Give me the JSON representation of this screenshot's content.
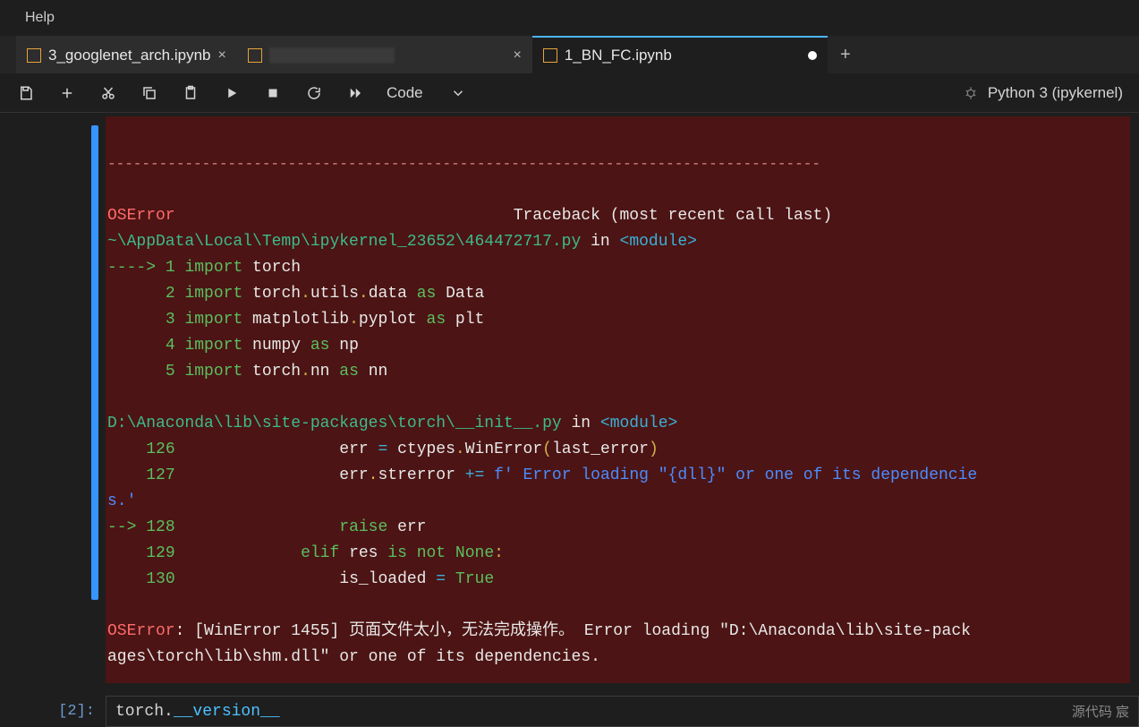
{
  "menu": {
    "help": "Help"
  },
  "tabs": [
    {
      "label": "3_googlenet_arch.ipynb",
      "active": false,
      "dirty": false
    },
    {
      "label": "",
      "active": false,
      "dirty": false,
      "redacted": true
    },
    {
      "label": "1_BN_FC.ipynb",
      "active": true,
      "dirty": true
    }
  ],
  "toolbar": {
    "cell_type": "Code",
    "kernel": "Python 3 (ipykernel)"
  },
  "traceback": {
    "error_name": "OSError",
    "header_right": "Traceback (most recent call last)",
    "loc1_path": "~\\AppData\\Local\\Temp\\ipykernel_23652\\464472717.py",
    "in_label": " in ",
    "module_label": "<module>",
    "src1": [
      {
        "arrow": "----> ",
        "lineno": "1",
        "body_parts": [
          [
            "kw",
            "import"
          ],
          [
            "w",
            " torch"
          ]
        ]
      },
      {
        "arrow": "      ",
        "lineno": "2",
        "body_parts": [
          [
            "kw",
            "import"
          ],
          [
            "w",
            " torch"
          ],
          [
            "y",
            "."
          ],
          [
            "w",
            "utils"
          ],
          [
            "y",
            "."
          ],
          [
            "w",
            "data "
          ],
          [
            "kw",
            "as"
          ],
          [
            "w",
            " Data"
          ]
        ]
      },
      {
        "arrow": "      ",
        "lineno": "3",
        "body_parts": [
          [
            "kw",
            "import"
          ],
          [
            "w",
            " matplotlib"
          ],
          [
            "y",
            "."
          ],
          [
            "w",
            "pyplot "
          ],
          [
            "kw",
            "as"
          ],
          [
            "w",
            " plt"
          ]
        ]
      },
      {
        "arrow": "      ",
        "lineno": "4",
        "body_parts": [
          [
            "kw",
            "import"
          ],
          [
            "w",
            " numpy "
          ],
          [
            "kw",
            "as"
          ],
          [
            "w",
            " np"
          ]
        ]
      },
      {
        "arrow": "      ",
        "lineno": "5",
        "body_parts": [
          [
            "kw",
            "import"
          ],
          [
            "w",
            " torch"
          ],
          [
            "y",
            "."
          ],
          [
            "w",
            "nn "
          ],
          [
            "kw",
            "as"
          ],
          [
            "w",
            " nn"
          ]
        ]
      }
    ],
    "loc2_path": "D:\\Anaconda\\lib\\site-packages\\torch\\__init__.py",
    "src2": [
      {
        "arrow": "    ",
        "lineno": "126",
        "body_parts": [
          [
            "w",
            "                err "
          ],
          [
            "op",
            "="
          ],
          [
            "w",
            " ctypes"
          ],
          [
            "y",
            "."
          ],
          [
            "w",
            "WinError"
          ],
          [
            "y",
            "("
          ],
          [
            "w",
            "last_error"
          ],
          [
            "y",
            ")"
          ]
        ]
      },
      {
        "arrow": "    ",
        "lineno": "127",
        "body_parts": [
          [
            "w",
            "                err"
          ],
          [
            "y",
            "."
          ],
          [
            "w",
            "strerror "
          ],
          [
            "op",
            "+="
          ],
          [
            "w",
            " "
          ],
          [
            "str",
            "f' Error loading \"{dll}\" or one of its dependencie"
          ]
        ]
      }
    ],
    "wrap_continuation": "s.'",
    "src3": [
      {
        "arrow": "--> ",
        "lineno": "128",
        "body_parts": [
          [
            "w",
            "                "
          ],
          [
            "kw",
            "raise"
          ],
          [
            "w",
            " err"
          ]
        ]
      },
      {
        "arrow": "    ",
        "lineno": "129",
        "body_parts": [
          [
            "w",
            "            "
          ],
          [
            "kw",
            "elif"
          ],
          [
            "w",
            " res "
          ],
          [
            "kw",
            "is not"
          ],
          [
            "w",
            " "
          ],
          [
            "bool",
            "None"
          ],
          [
            "y",
            ":"
          ]
        ]
      },
      {
        "arrow": "    ",
        "lineno": "130",
        "body_parts": [
          [
            "w",
            "                is_loaded "
          ],
          [
            "op",
            "="
          ],
          [
            "w",
            " "
          ],
          [
            "bool",
            "True"
          ]
        ]
      }
    ],
    "final_error_name": "OSError",
    "final_msg": ": [WinError 1455] 页面文件太小，无法完成操作。 Error loading \"D:\\Anaconda\\lib\\site-pack\nages\\torch\\lib\\shm.dll\" or one of its dependencies."
  },
  "next_cell": {
    "prompt": "[2]:",
    "code_prefix": "torch.",
    "code_dunder": "__version__",
    "hint": "源代码  宸"
  }
}
